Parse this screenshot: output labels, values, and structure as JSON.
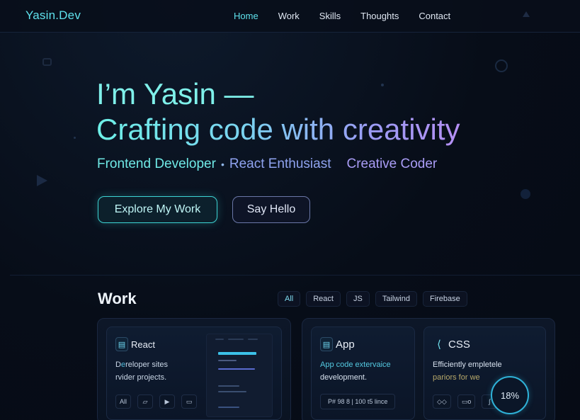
{
  "nav": {
    "brand": "Yasin.Dev",
    "links": [
      {
        "label": "Home",
        "active": true
      },
      {
        "label": "Work",
        "active": false
      },
      {
        "label": "Skills",
        "active": false
      },
      {
        "label": "Thoughts",
        "active": false
      },
      {
        "label": "Contact",
        "active": false
      }
    ]
  },
  "hero": {
    "title_line1": "I’m Yasin —",
    "title_line2": "Crafting code with creativity",
    "roles": [
      "Frontend Developer",
      "React Enthusiast",
      "Creative Coder"
    ],
    "role_separator": "•",
    "primary_button": "Explore My Work",
    "secondary_button": "Say Hello"
  },
  "work": {
    "title": "Work",
    "filters": [
      "All",
      "React",
      "JS",
      "Tailwind",
      "Firebase"
    ],
    "active_filter": "All",
    "cards": [
      {
        "icon": "file-icon",
        "label": "React",
        "desc_line1_a": "D",
        "desc_line1_b": "e",
        "desc_line1_c": "reloper sites",
        "desc_line2": "rvider projects.",
        "chips": [
          "All",
          "▱",
          "▶",
          "▭"
        ]
      },
      {
        "icon": "file-icon",
        "label": "App",
        "desc_line1": "App code extervaice",
        "desc_line2": "development.",
        "meta": "P# 98 8 | 100 t5 lince"
      },
      {
        "icon": "code-icon",
        "label": "CSS",
        "desc_line1": "Efficiently empletele",
        "desc_line2": "pariors for we",
        "chips": [
          "◇◇",
          "▭o",
          "∫"
        ],
        "gauge": "18%"
      }
    ]
  },
  "colors": {
    "accent_cyan": "#5fe3ee",
    "accent_violet": "#a99cf5",
    "background": "#070d18"
  }
}
